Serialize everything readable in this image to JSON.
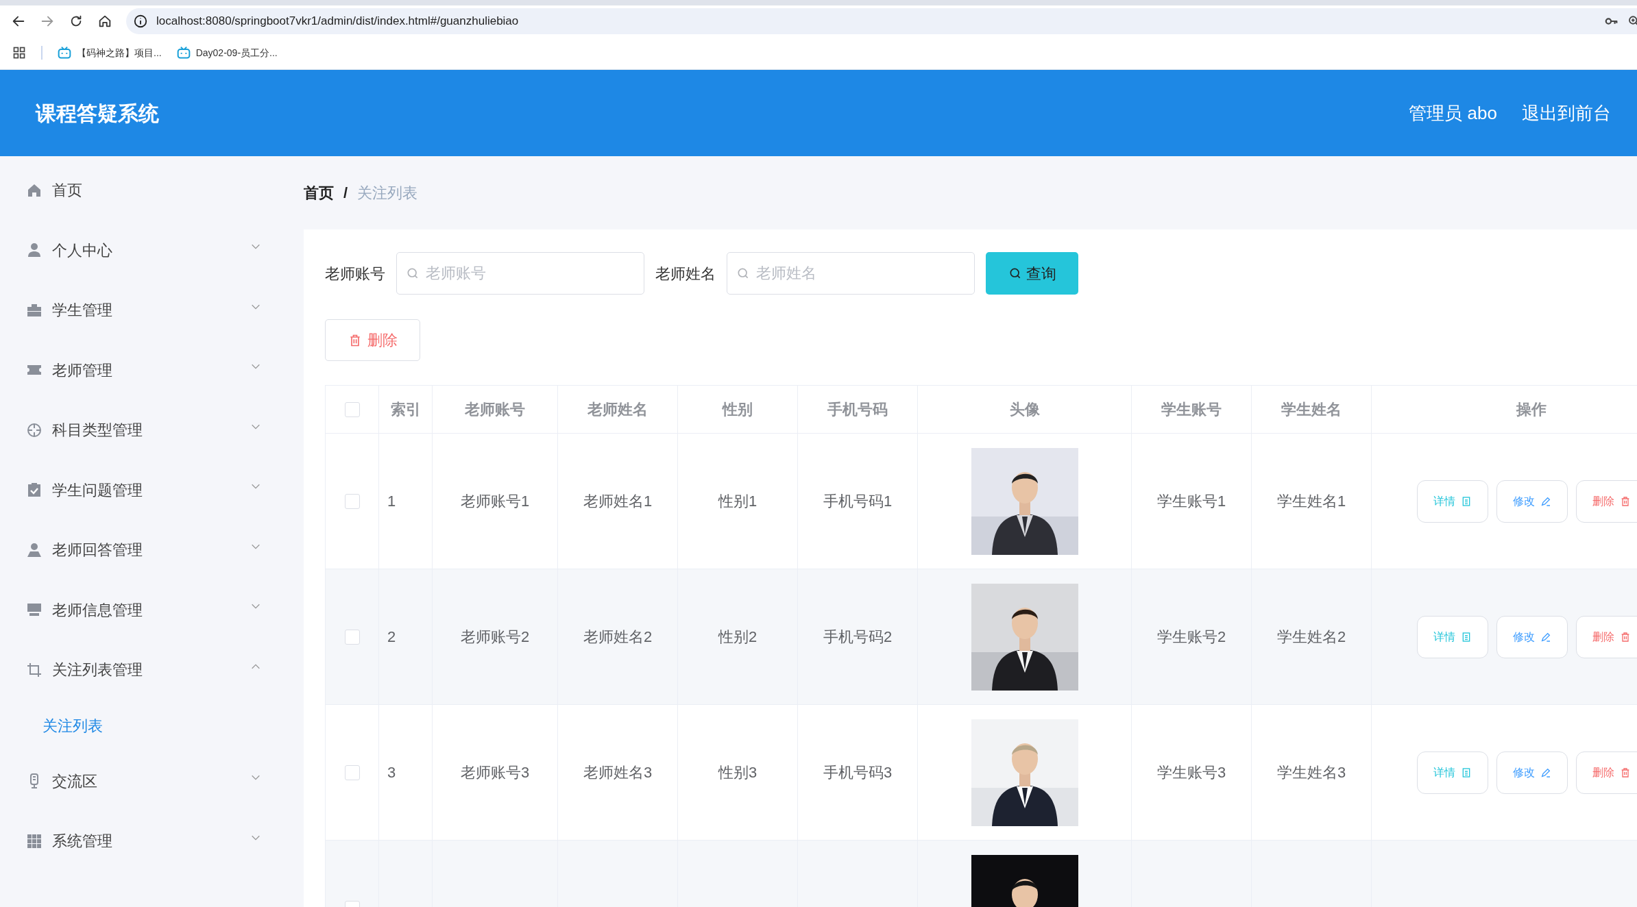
{
  "browser": {
    "url": "localhost:8080/springboot7vkr1/admin/dist/index.html#/guanzhuliebiao",
    "bookmarks": [
      "【码神之路】项目...",
      "Day02-09-员工分..."
    ]
  },
  "header": {
    "title": "课程答疑系统",
    "user": "管理员 abo",
    "logout": "退出到前台"
  },
  "sidebar": {
    "items": [
      {
        "label": "首页"
      },
      {
        "label": "个人中心",
        "expanded": false
      },
      {
        "label": "学生管理",
        "expanded": false
      },
      {
        "label": "老师管理",
        "expanded": false
      },
      {
        "label": "科目类型管理",
        "expanded": false
      },
      {
        "label": "学生问题管理",
        "expanded": false
      },
      {
        "label": "老师回答管理",
        "expanded": false
      },
      {
        "label": "老师信息管理",
        "expanded": false
      },
      {
        "label": "关注列表管理",
        "expanded": true,
        "children": [
          {
            "label": "关注列表",
            "selected": true
          }
        ]
      },
      {
        "label": "交流区",
        "expanded": false
      },
      {
        "label": "系统管理",
        "expanded": false
      }
    ]
  },
  "breadcrumb": {
    "items": [
      "首页",
      "关注列表"
    ],
    "separator": "/"
  },
  "search": {
    "fields": [
      {
        "label": "老师账号",
        "placeholder": "老师账号"
      },
      {
        "label": "老师姓名",
        "placeholder": "老师姓名"
      }
    ],
    "button": "查询"
  },
  "delete_button": "删除",
  "table": {
    "select_all": false,
    "columns": [
      "索引",
      "老师账号",
      "老师姓名",
      "性别",
      "手机号码",
      "头像",
      "学生账号",
      "学生姓名",
      "操作"
    ],
    "rows": [
      {
        "checked": false,
        "index": "1",
        "teacher_account": "老师账号1",
        "teacher_name": "老师姓名1",
        "gender": "性别1",
        "phone": "手机号码1",
        "avatar": {
          "kind": "picture"
        },
        "student_account": "学生账号1",
        "student_name": "学生姓名1",
        "actions": [
          "详情",
          "修改",
          "删除"
        ]
      },
      {
        "checked": false,
        "index": "2",
        "teacher_account": "老师账号2",
        "teacher_name": "老师姓名2",
        "gender": "性别2",
        "phone": "手机号码2",
        "avatar": {
          "kind": "picture"
        },
        "student_account": "学生账号2",
        "student_name": "学生姓名2",
        "actions": [
          "详情",
          "修改",
          "删除"
        ]
      },
      {
        "checked": false,
        "index": "3",
        "teacher_account": "老师账号3",
        "teacher_name": "老师姓名3",
        "gender": "性别3",
        "phone": "手机号码3",
        "avatar": {
          "kind": "picture"
        },
        "student_account": "学生账号3",
        "student_name": "学生姓名3",
        "actions": [
          "详情",
          "修改",
          "删除"
        ]
      },
      {
        "checked": false,
        "avatar": {
          "kind": "picture"
        }
      }
    ]
  }
}
